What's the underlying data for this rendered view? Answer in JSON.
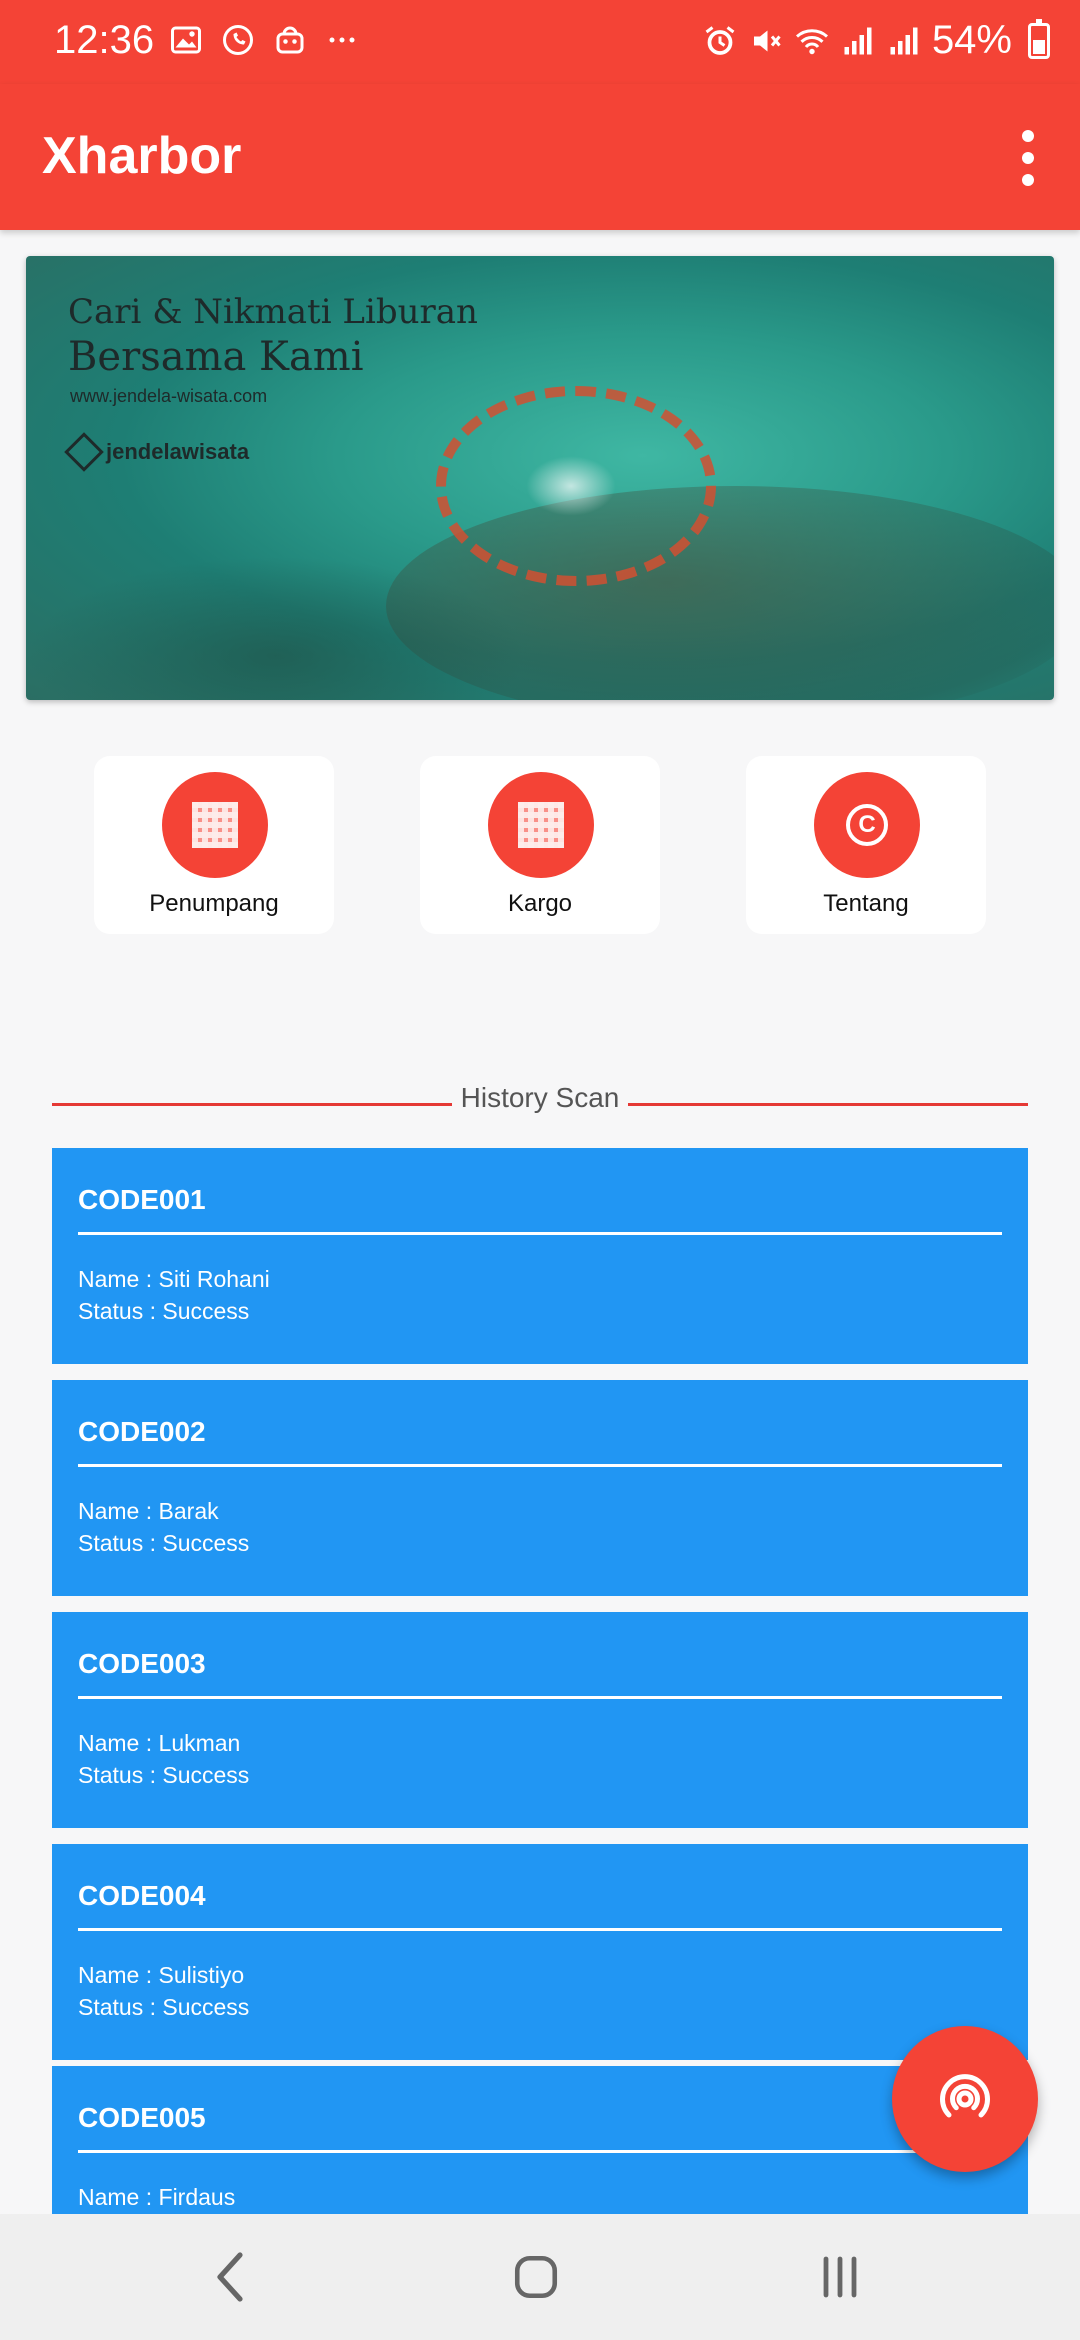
{
  "status_bar": {
    "time": "12:36",
    "battery": "54%",
    "left_icons": [
      "image-icon",
      "whatsapp-icon",
      "shop-icon",
      "more-dots-icon"
    ],
    "right_icons": [
      "alarm-icon",
      "mute-icon",
      "wifi-icon",
      "signal-icon",
      "signal-icon",
      "battery-icon"
    ]
  },
  "app_bar": {
    "title": "Xharbor",
    "menu_icon": "overflow-menu-icon"
  },
  "banner": {
    "headline_line1": "Cari & Nikmati Liburan",
    "headline_line2": "Bersama Kami",
    "url": "www.jendela-wisata.com",
    "logo_text": "jendelawisata"
  },
  "menu": [
    {
      "label": "Penumpang",
      "icon": "qr-code-icon"
    },
    {
      "label": "Kargo",
      "icon": "qr-code-icon"
    },
    {
      "label": "Tentang",
      "icon": "copyright-icon"
    }
  ],
  "history": {
    "title": "History Scan",
    "items": [
      {
        "code": "CODE001",
        "name": "Name : Siti Rohani",
        "status": "Status : Success"
      },
      {
        "code": "CODE002",
        "name": "Name : Barak",
        "status": "Status : Success"
      },
      {
        "code": "CODE003",
        "name": "Name : Lukman",
        "status": "Status : Success"
      },
      {
        "code": "CODE004",
        "name": "Name : Sulistiyo",
        "status": "Status : Success"
      },
      {
        "code": "CODE005",
        "name": "Name : Firdaus",
        "status": ""
      }
    ]
  },
  "fab": {
    "icon": "nfc-scan-icon"
  },
  "nav_bar": {
    "buttons": [
      "back-icon",
      "home-icon",
      "recents-icon"
    ]
  },
  "colors": {
    "primary": "#f44336",
    "card": "#2196f3",
    "background": "#f7f7f8"
  }
}
